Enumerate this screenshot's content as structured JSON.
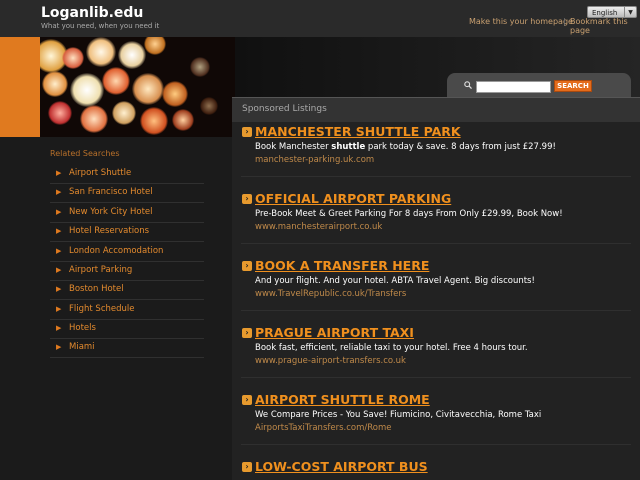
{
  "header": {
    "site_title": "Loganlib.edu",
    "tagline": "What you need, when you need it",
    "language": "English",
    "home_link": "Make this your homepage",
    "separator": "|",
    "bookmark_link": "Bookmark this page"
  },
  "search": {
    "placeholder": "",
    "button_label": "SEARCH"
  },
  "sidebar": {
    "title": "Related Searches",
    "items": [
      {
        "label": "Airport Shuttle"
      },
      {
        "label": "San Francisco Hotel"
      },
      {
        "label": "New York City Hotel"
      },
      {
        "label": "Hotel Reservations"
      },
      {
        "label": "London Accomodation"
      },
      {
        "label": "Airport Parking"
      },
      {
        "label": "Boston Hotel"
      },
      {
        "label": "Flight Schedule"
      },
      {
        "label": "Hotels"
      },
      {
        "label": "Miami"
      }
    ]
  },
  "listings": {
    "title": "Sponsored Listings",
    "ads": [
      {
        "title": "MANCHESTER SHUTTLE PARK",
        "desc_pre": "Book Manchester ",
        "desc_bold": "shuttle",
        "desc_post": " park today & save. 8 days from just £27.99!",
        "url": "manchester-parking.uk.com"
      },
      {
        "title": "OFFICIAL AIRPORT PARKING",
        "desc_pre": "Pre-Book Meet & Greet Parking For 8 days From Only £29.99, Book Now!",
        "desc_bold": "",
        "desc_post": "",
        "url": "www.manchesterairport.co.uk"
      },
      {
        "title": "BOOK A TRANSFER HERE",
        "desc_pre": "And your flight. And your hotel. ABTA Travel Agent. Big discounts!",
        "desc_bold": "",
        "desc_post": "",
        "url": "www.TravelRepublic.co.uk/Transfers"
      },
      {
        "title": "PRAGUE AIRPORT TAXI",
        "desc_pre": "Book fast, efficient, reliable taxi to your hotel. Free 4 hours tour.",
        "desc_bold": "",
        "desc_post": "",
        "url": "www.prague-airport-transfers.co.uk"
      },
      {
        "title": "AIRPORT SHUTTLE ROME",
        "desc_pre": "We Compare Prices - You Save! Fiumicino, Civitavecchia, Rome Taxi",
        "desc_bold": "",
        "desc_post": "",
        "url": "AirportsTaxiTransfers.com/Rome"
      },
      {
        "title": "LOW-COST AIRPORT BUS",
        "desc_pre": "",
        "desc_bold": "",
        "desc_post": "",
        "url": ""
      }
    ]
  },
  "colors": {
    "accent": "#e07a1f",
    "link": "#f0901e",
    "background": "#1a1a1a"
  }
}
